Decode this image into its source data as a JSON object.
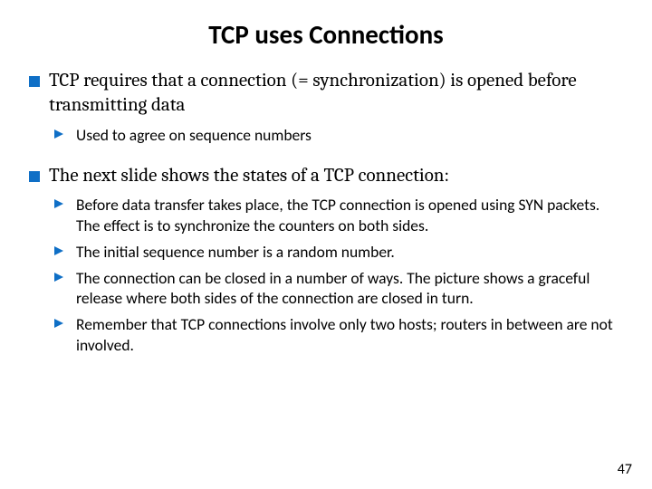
{
  "title": "TCP uses Connections",
  "points": [
    {
      "text": "TCP requires that a connection (= synchronization) is opened before transmitting data",
      "sub": [
        "Used to agree on sequence numbers"
      ]
    },
    {
      "text": "The next slide shows the states of a TCP connection:",
      "sub": [
        "Before data transfer takes place, the TCP connection is opened using SYN packets. The effect is to synchronize the counters on both sides.",
        "The initial sequence number is a random number.",
        "The connection can be closed in a number of ways. The picture shows a graceful release where both sides of the connection are closed in turn.",
        "Remember that TCP connections involve only two hosts; routers in between are not involved."
      ]
    }
  ],
  "pageNumber": "47"
}
